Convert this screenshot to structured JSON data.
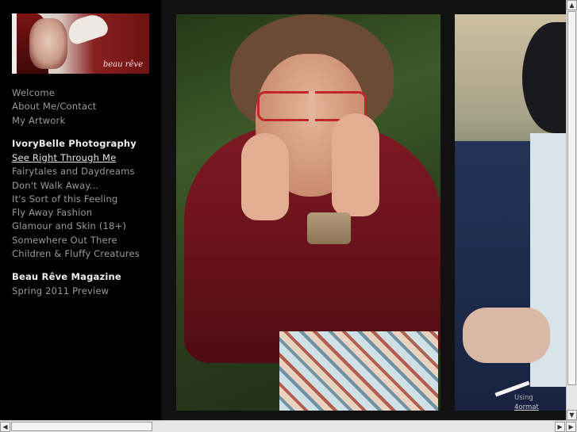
{
  "logo": {
    "brand_text": "beau rêve"
  },
  "nav_top": [
    "Welcome",
    "About Me/Contact",
    "My Artwork"
  ],
  "section1": {
    "heading": "IvoryBelle Photography",
    "items": [
      "See Right Through Me",
      "Fairytales and Daydreams",
      "Don't Walk Away...",
      "It's Sort of this Feeling",
      "Fly Away Fashion",
      "Glamour and Skin (18+)",
      "Somewhere Out There",
      "Children & Fluffy Creatures"
    ],
    "active_index": 0
  },
  "section2": {
    "heading": "Beau Rêve Magazine",
    "items": [
      "Spring 2011 Preview"
    ]
  },
  "credit": {
    "prefix": "Using",
    "link": "4ormat"
  },
  "scrollbars": {
    "up_arrow": "▲",
    "down_arrow": "▼",
    "left_arrow": "◀",
    "right_arrow": "▶"
  }
}
